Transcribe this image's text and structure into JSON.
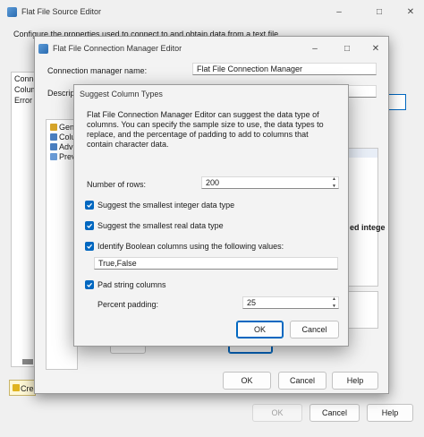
{
  "outer": {
    "title": "Flat File Source Editor",
    "description": "Configure the properties used to connect to and obtain data from a text file.",
    "nav": [
      "Connection",
      "Colum",
      "Error O"
    ],
    "status_text": "Crea",
    "buttons": {
      "ok": "OK",
      "cancel": "Cancel",
      "help": "Help"
    }
  },
  "connmgr": {
    "title": "Flat File Connection Manager Editor",
    "name_label": "Connection manager name:",
    "name_value": "Flat File Connection Manager",
    "desc_label": "Descripti",
    "nav": [
      "Gen",
      "Colu",
      "Adv",
      "Prev"
    ],
    "behind_text": "ed intege",
    "buttons": {
      "ok": "OK",
      "cancel": "Cancel",
      "help": "Help"
    }
  },
  "suggest": {
    "title": "Suggest Column Types",
    "intro": "Flat File Connection Manager Editor can suggest the data type of columns. You can specify the sample size to use, the data types to replace, and the percentage of padding to add to columns that contain character data.",
    "rows_label": "Number of rows:",
    "rows_value": "200",
    "opt_integer": "Suggest the smallest integer data type",
    "opt_real": "Suggest the smallest real data type",
    "opt_boolean": "Identify Boolean columns using the following values:",
    "boolean_values": "True,False",
    "opt_pad": "Pad string columns",
    "padding_label": "Percent padding:",
    "padding_value": "25",
    "buttons": {
      "ok": "OK",
      "cancel": "Cancel"
    }
  }
}
